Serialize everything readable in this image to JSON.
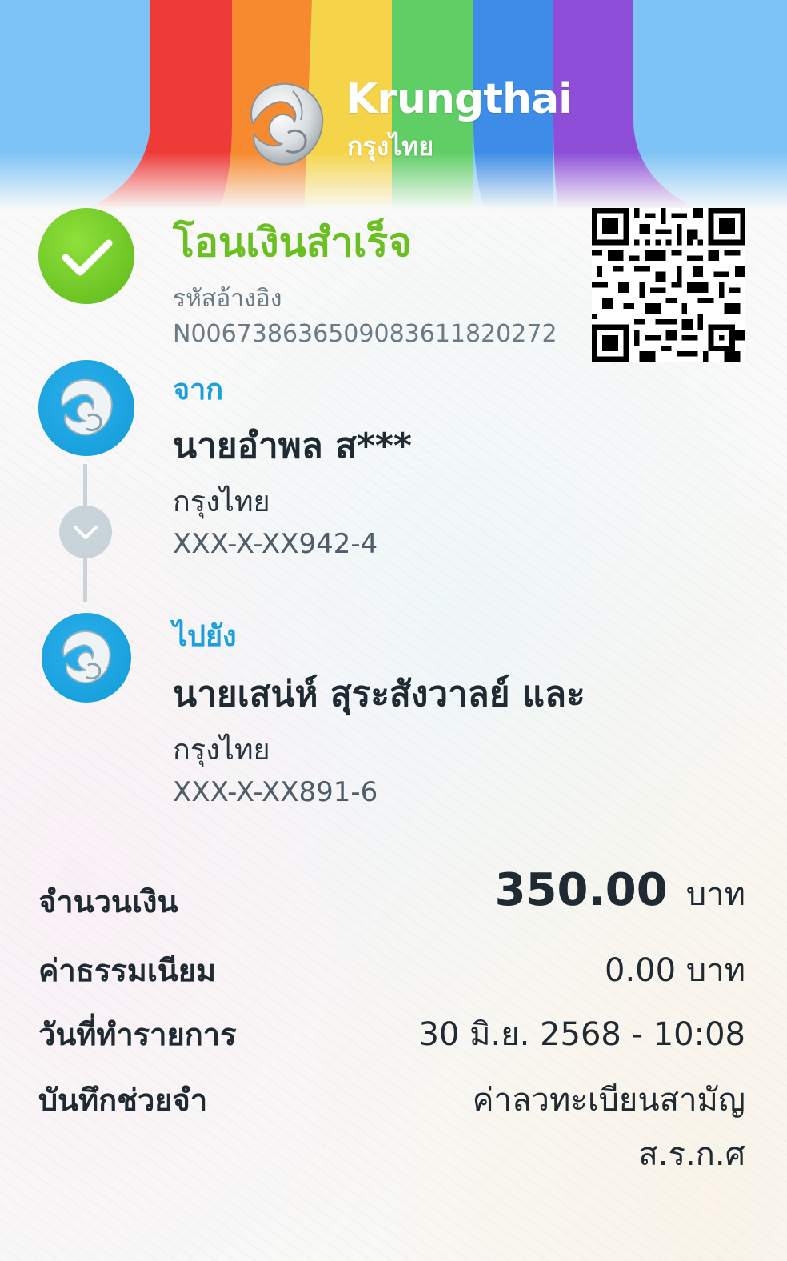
{
  "header": {
    "brand_en": "Krungthai",
    "brand_th": "กรุงไทย",
    "rainbow_colors": [
      "#ee3b38",
      "#f7892e",
      "#f6d44a",
      "#5fce65",
      "#3d8de8",
      "#8e4ed8"
    ],
    "sky_color": "#7ec3f5"
  },
  "status": {
    "title": "โอนเงินสำเร็จ",
    "ref_label": "รหัสอ้างอิง",
    "ref_value": "N006738636509083611820272",
    "icon": "check-icon",
    "color": "#6cbf22"
  },
  "from": {
    "label": "จาก",
    "name": "นายอำพล ส***",
    "bank": "กรุงไทย",
    "account": "XXX-X-XX942-4"
  },
  "to": {
    "label": "ไปยัง",
    "name": "นายเสน่ห์ สุระสังวาลย์ และ",
    "bank": "กรุงไทย",
    "account": "XXX-X-XX891-6"
  },
  "details": {
    "amount_label": "จำนวนเงิน",
    "amount_value": "350.00",
    "amount_unit": "บาท",
    "fee_label": "ค่าธรรมเนียม",
    "fee_value": "0.00 บาท",
    "date_label": "วันที่ทำรายการ",
    "date_value": "30 มิ.ย. 2568 - 10:08",
    "memo_label": "บันทึกช่วยจำ",
    "memo_line1": "ค่าลวทะเบียนสามัญ",
    "memo_line2": "ส.ร.ก.ศ"
  }
}
